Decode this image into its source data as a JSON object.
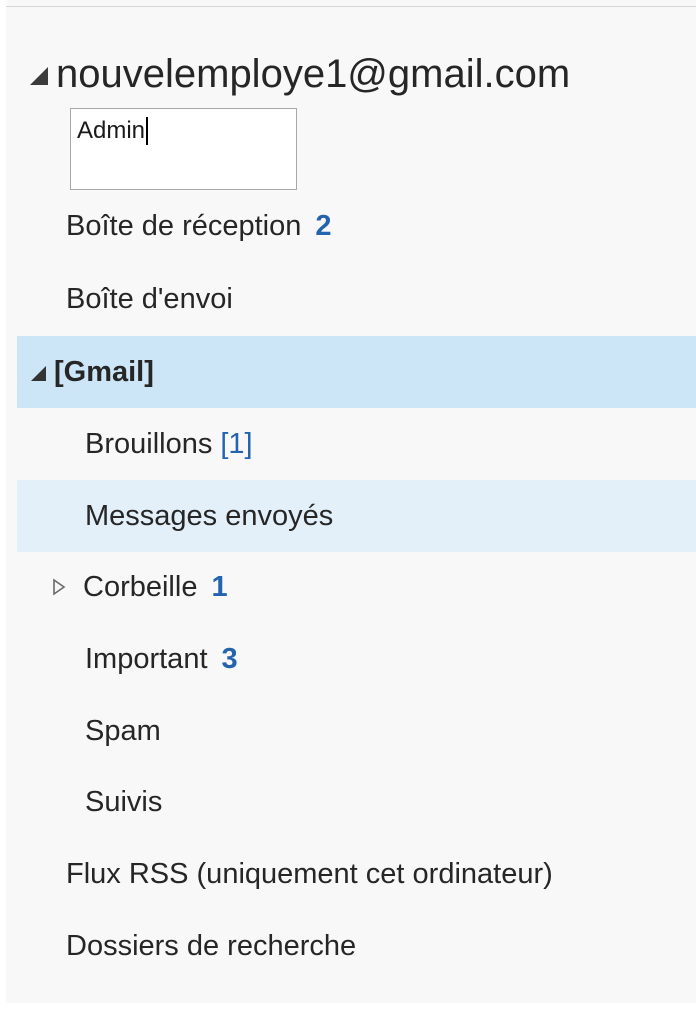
{
  "account": {
    "email": "nouvelemploye1@gmail.com"
  },
  "rename": {
    "value": "Admin"
  },
  "folders": {
    "inbox": {
      "label": "Boîte de réception",
      "count": "2"
    },
    "outbox": {
      "label": "Boîte d'envoi"
    },
    "gmail": {
      "label": "[Gmail]"
    },
    "drafts": {
      "label": "Brouillons",
      "count": "[1]"
    },
    "sent": {
      "label": "Messages envoyés"
    },
    "trash": {
      "label": "Corbeille",
      "count": "1"
    },
    "important": {
      "label": "Important",
      "count": "3"
    },
    "spam": {
      "label": "Spam"
    },
    "starred": {
      "label": "Suivis"
    },
    "rss": {
      "label": "Flux RSS (uniquement cet ordinateur)"
    },
    "search": {
      "label": "Dossiers de recherche"
    }
  },
  "colors": {
    "selected_bg": "#cde6f7",
    "hover_bg": "#e3f0fa",
    "count_blue": "#2463b0"
  },
  "icons": {
    "expanded": "triangle-down-icon",
    "collapsed": "triangle-right-outline-icon"
  }
}
